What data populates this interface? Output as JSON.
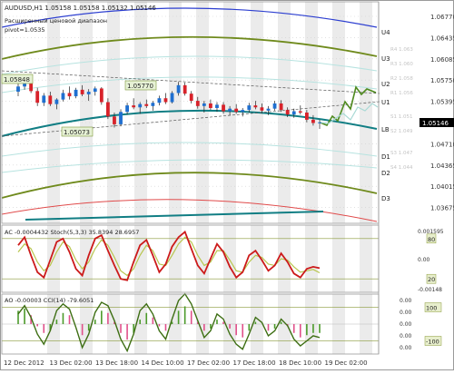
{
  "colors": {
    "frame": "#9a9a9a",
    "band": "#ebebeb",
    "grid": "#cfcfcf",
    "candle_up": "#1f6fd0",
    "candle_down": "#d8222a",
    "candle_wick": "#222222",
    "env_blue": "#2c3ed0",
    "env_green": "#6f8a1c",
    "env_light": "#b7e3e0",
    "ma_teal": "#117e84",
    "red_curve": "#e04a4a",
    "forecast_green": "#4f8a1f",
    "forecast_light": "#a9d9d5",
    "dashed": "#555555",
    "price_box_bg": "#000000",
    "price_box_text": "#ffffff",
    "osc_red": "#cc1a1a",
    "osc_yellow": "#b8c64e",
    "cci_green": "#3d6e13",
    "hist_green": "#4b9a2a",
    "hist_red": "#e0508a",
    "level_box": "#e7eecc",
    "level_box_border": "#8a9a3a",
    "label_text": "#222222",
    "axis_text": "#333333"
  },
  "header": {
    "symbol_line": "AUDUSD,H1  1.05158 1.05158 1.05132 1.05146",
    "subtitle_line1": "Расширенный ценовой диапазон",
    "subtitle_line2": "pivot=1.0535"
  },
  "price_box": "1.05146",
  "annotations": [
    {
      "text": "1.05848"
    },
    {
      "text": "1.05770"
    },
    {
      "text": "1.05073"
    }
  ],
  "level_labels": [
    {
      "text": "U4"
    },
    {
      "text": "U3"
    },
    {
      "text": "U2"
    },
    {
      "text": "U1"
    },
    {
      "text": "LB"
    },
    {
      "text": "D1"
    },
    {
      "text": "D2"
    },
    {
      "text": "D3"
    }
  ],
  "faint_labels": [
    {
      "text": "R4 1.063"
    },
    {
      "text": "R3 1.060"
    },
    {
      "text": "R2 1.058"
    },
    {
      "text": "R1 1.056"
    },
    {
      "text": "S1 1.051"
    },
    {
      "text": "S2 1.049"
    },
    {
      "text": "S3 1.047"
    },
    {
      "text": "S4 1.044"
    }
  ],
  "indicator_titles": {
    "stoch": "AC -0.0004432  Stoch(5,3,3) 35.8394 28.6957",
    "cci": "AO -0.00003  CCI(14) -79.6051"
  },
  "stoch_levels": [
    {
      "text": "80"
    },
    {
      "text": "20"
    }
  ],
  "cci_levels": [
    {
      "text": "100"
    },
    {
      "text": "-100"
    }
  ],
  "price_axis": {
    "ticks": [
      "1.06770",
      "1.06435",
      "1.06085",
      "1.05750",
      "1.05395",
      "1.05055",
      "1.04710",
      "1.04365",
      "1.04015",
      "1.03675"
    ],
    "ac_ticks": [
      "0.001595",
      "0.00",
      "-0.00148"
    ],
    "ao_ticks": [
      "0.00",
      "0.00",
      "0.00",
      "0.00",
      "0.00"
    ]
  },
  "time_axis": [
    "12 Dec 2012",
    "13 Dec 02:00",
    "13 Dec 18:00",
    "14 Dec 10:00",
    "17 Dec 02:00",
    "17 Dec 18:00",
    "18 Dec 10:00",
    "19 Dec 02:00"
  ],
  "chart_data": {
    "type": "candlestick",
    "symbol": "AUDUSD",
    "timeframe": "H1",
    "last_price": 1.05146,
    "ylim": [
      1.036,
      1.07
    ],
    "candles": [
      [
        1.0562,
        1.0575,
        1.0555,
        1.057
      ],
      [
        1.057,
        1.0585,
        1.0565,
        1.058
      ],
      [
        1.058,
        1.0582,
        1.056,
        1.0563
      ],
      [
        1.0563,
        1.0568,
        1.054,
        1.0545
      ],
      [
        1.0545,
        1.056,
        1.054,
        1.0556
      ],
      [
        1.0556,
        1.0562,
        1.054,
        1.0543
      ],
      [
        1.0543,
        1.0552,
        1.0535,
        1.055
      ],
      [
        1.055,
        1.0565,
        1.0547,
        1.056
      ],
      [
        1.056,
        1.057,
        1.055,
        1.0555
      ],
      [
        1.0555,
        1.0568,
        1.0552,
        1.0565
      ],
      [
        1.0565,
        1.0572,
        1.0555,
        1.0558
      ],
      [
        1.0558,
        1.0566,
        1.0548,
        1.0562
      ],
      [
        1.0562,
        1.057,
        1.0556,
        1.0567
      ],
      [
        1.0567,
        1.0569,
        1.0542,
        1.0546
      ],
      [
        1.0546,
        1.0552,
        1.052,
        1.0524
      ],
      [
        1.0524,
        1.053,
        1.0507,
        1.0512
      ],
      [
        1.0512,
        1.0535,
        1.0509,
        1.0531
      ],
      [
        1.0531,
        1.0545,
        1.0527,
        1.0541
      ],
      [
        1.0541,
        1.0552,
        1.0535,
        1.0538
      ],
      [
        1.0538,
        1.0546,
        1.0528,
        1.0543
      ],
      [
        1.0543,
        1.055,
        1.0537,
        1.054
      ],
      [
        1.054,
        1.0548,
        1.0533,
        1.0545
      ],
      [
        1.0545,
        1.0556,
        1.0541,
        1.0552
      ],
      [
        1.0552,
        1.056,
        1.0543,
        1.0546
      ],
      [
        1.0546,
        1.0563,
        1.0544,
        1.056
      ],
      [
        1.056,
        1.0577,
        1.0556,
        1.0572
      ],
      [
        1.0572,
        1.0576,
        1.0556,
        1.0559
      ],
      [
        1.0559,
        1.0563,
        1.0544,
        1.0548
      ],
      [
        1.0548,
        1.0554,
        1.0536,
        1.054
      ],
      [
        1.054,
        1.0548,
        1.053,
        1.0544
      ],
      [
        1.0544,
        1.055,
        1.0534,
        1.0537
      ],
      [
        1.0537,
        1.0546,
        1.0531,
        1.0542
      ],
      [
        1.0542,
        1.0546,
        1.0528,
        1.0532
      ],
      [
        1.0532,
        1.054,
        1.0526,
        1.0536
      ],
      [
        1.0536,
        1.0543,
        1.0528,
        1.0531
      ],
      [
        1.0531,
        1.0537,
        1.0524,
        1.0534
      ],
      [
        1.0534,
        1.0545,
        1.053,
        1.0541
      ],
      [
        1.0541,
        1.0548,
        1.0535,
        1.0538
      ],
      [
        1.0538,
        1.0544,
        1.0529,
        1.0533
      ],
      [
        1.0533,
        1.054,
        1.0526,
        1.0536
      ],
      [
        1.0536,
        1.0548,
        1.0533,
        1.0544
      ],
      [
        1.0544,
        1.0549,
        1.0531,
        1.0534
      ],
      [
        1.0534,
        1.0538,
        1.0523,
        1.0527
      ],
      [
        1.0527,
        1.0536,
        1.0522,
        1.0532
      ],
      [
        1.0532,
        1.0541,
        1.0527,
        1.053
      ],
      [
        1.053,
        1.0534,
        1.0515,
        1.0519
      ],
      [
        1.0519,
        1.0526,
        1.051,
        1.0514
      ],
      [
        1.0514,
        1.0519,
        1.0505,
        1.0515
      ]
    ],
    "stochastic": {
      "main": [
        70,
        82,
        55,
        30,
        22,
        48,
        75,
        80,
        60,
        35,
        25,
        55,
        80,
        85,
        62,
        40,
        20,
        18,
        45,
        70,
        78,
        55,
        30,
        42,
        68,
        82,
        90,
        65,
        40,
        28,
        50,
        72,
        60,
        38,
        22,
        30,
        55,
        62,
        48,
        32,
        40,
        58,
        45,
        28,
        22,
        35,
        38,
        36
      ],
      "signal": [
        60,
        72,
        65,
        45,
        32,
        40,
        60,
        75,
        68,
        48,
        35,
        45,
        65,
        78,
        70,
        52,
        32,
        25,
        35,
        55,
        70,
        62,
        42,
        40,
        55,
        72,
        82,
        75,
        55,
        40,
        45,
        62,
        62,
        48,
        32,
        30,
        45,
        55,
        52,
        42,
        40,
        50,
        48,
        38,
        30,
        32,
        34,
        29
      ],
      "levels": [
        80,
        20
      ]
    },
    "cci": {
      "cci": [
        60,
        110,
        40,
        -60,
        -120,
        -40,
        80,
        120,
        90,
        -20,
        -140,
        -60,
        70,
        130,
        110,
        20,
        -90,
        -160,
        -60,
        80,
        120,
        60,
        -40,
        -90,
        30,
        140,
        180,
        120,
        20,
        -80,
        -40,
        60,
        30,
        -60,
        -120,
        -150,
        -60,
        40,
        10,
        -70,
        -40,
        30,
        -10,
        -90,
        -130,
        -100,
        -70,
        -80
      ],
      "ao": [
        0.0006,
        0.0007,
        0.0004,
        -0.0001,
        -0.0004,
        -0.0003,
        0.0002,
        0.0005,
        0.0004,
        0.0,
        -0.0005,
        -0.0003,
        0.0002,
        0.0006,
        0.0005,
        0.0001,
        -0.0004,
        -0.0007,
        -0.0004,
        0.0002,
        0.0005,
        0.0003,
        -0.0001,
        -0.0003,
        0.0001,
        0.0006,
        0.0008,
        0.0006,
        0.0001,
        -0.0003,
        -0.0002,
        0.0002,
        0.0001,
        -0.0002,
        -0.0005,
        -0.0006,
        -0.0003,
        0.0001,
        0.0,
        -0.0003,
        -0.0002,
        0.0001,
        -0.0001,
        -0.0004,
        -0.0006,
        -0.0005,
        -0.0004,
        -0.0004
      ],
      "levels": [
        100,
        -100
      ]
    }
  }
}
